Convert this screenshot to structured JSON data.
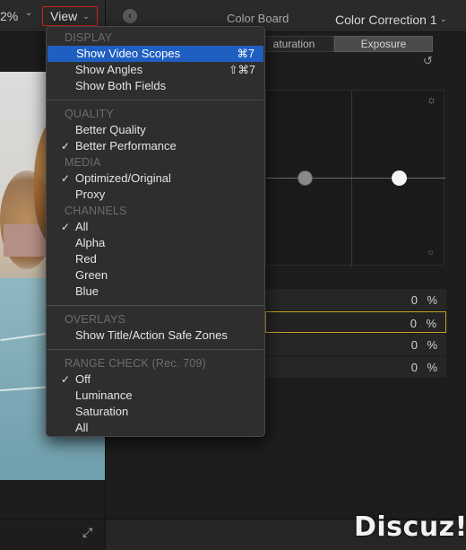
{
  "toolbar": {
    "zoom_value": "2%",
    "view_label": "View",
    "board_title": "Color Board",
    "correction_title": "Color Correction 1"
  },
  "color_board": {
    "tabs": [
      "aturation",
      "Exposure"
    ],
    "rows": [
      {
        "value": "0",
        "unit": "%"
      },
      {
        "value": "0",
        "unit": "%"
      },
      {
        "value": "0",
        "unit": "%"
      },
      {
        "value": "0",
        "unit": "%"
      }
    ]
  },
  "menu": {
    "display_header": "DISPLAY",
    "show_video_scopes": "Show Video Scopes",
    "show_video_scopes_shortcut": "⌘7",
    "show_angles": "Show Angles",
    "show_angles_shortcut": "⇧⌘7",
    "show_both_fields": "Show Both Fields",
    "quality_header": "QUALITY",
    "better_quality": "Better Quality",
    "better_performance": "Better Performance",
    "media_header": "MEDIA",
    "optimized_original": "Optimized/Original",
    "proxy": "Proxy",
    "channels_header": "CHANNELS",
    "all_channels": "All",
    "alpha": "Alpha",
    "red": "Red",
    "green": "Green",
    "blue": "Blue",
    "overlays_header": "OVERLAYS",
    "safe_zones": "Show Title/Action Safe Zones",
    "range_check_header": "RANGE CHECK (Rec. 709)",
    "off": "Off",
    "luminance": "Luminance",
    "saturation": "Saturation",
    "all_range": "All",
    "checkmark": "✓"
  },
  "watermark": "Discuz!",
  "icons": {
    "chevron": "⌄",
    "back": "‹",
    "reset": "↺",
    "sun": "☼",
    "expand": "⤢"
  }
}
